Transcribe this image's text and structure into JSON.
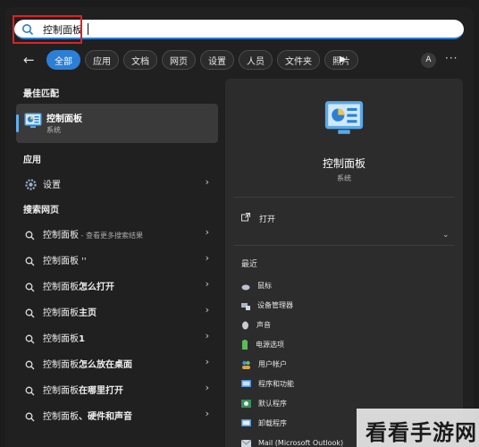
{
  "search": {
    "value": "控制面板"
  },
  "filters": [
    "全部",
    "应用",
    "文档",
    "网页",
    "设置",
    "人员",
    "文件夹",
    "照片"
  ],
  "avatar_letter": "A",
  "more_label": "···",
  "sections": {
    "best_match": "最佳匹配",
    "apps": "应用",
    "web_search": "搜索网页"
  },
  "best_match": {
    "title": "控制面板",
    "subtitle": "系统"
  },
  "apps": [
    {
      "label": "设置",
      "icon": "gear-icon"
    }
  ],
  "web_results": [
    {
      "main": "控制面板",
      "sub": " - 查看更多搜索结果"
    },
    {
      "main": "控制面板 ''",
      "sub": ""
    },
    {
      "main": "控制面板",
      "bold": "怎么打开"
    },
    {
      "main": "控制面板",
      "bold": "主页"
    },
    {
      "main": "控制面板",
      "bold": "1"
    },
    {
      "main": "控制面板",
      "bold": "怎么放在桌面"
    },
    {
      "main": "控制面板",
      "bold": "在哪里打开"
    },
    {
      "main": "控制面板",
      "bold": "、硬件和声音"
    }
  ],
  "detail": {
    "title": "控制面板",
    "subtitle": "系统",
    "open_label": "打开",
    "recent_label": "最近",
    "recent": [
      {
        "label": "鼠标",
        "icon": "mouse-icon"
      },
      {
        "label": "设备管理器",
        "icon": "device-manager-icon"
      },
      {
        "label": "声音",
        "icon": "sound-icon"
      },
      {
        "label": "电源选项",
        "icon": "battery-icon"
      },
      {
        "label": "用户帐户",
        "icon": "users-icon"
      },
      {
        "label": "程序和功能",
        "icon": "programs-icon"
      },
      {
        "label": "默认程序",
        "icon": "default-programs-icon"
      },
      {
        "label": "卸载程序",
        "icon": "uninstall-icon"
      },
      {
        "label": "Mail (Microsoft Outlook)",
        "icon": "mail-icon"
      }
    ]
  },
  "watermark": "看看手游网",
  "colors": {
    "accent": "#2b7fd6",
    "highlight_box": "#e02020"
  }
}
